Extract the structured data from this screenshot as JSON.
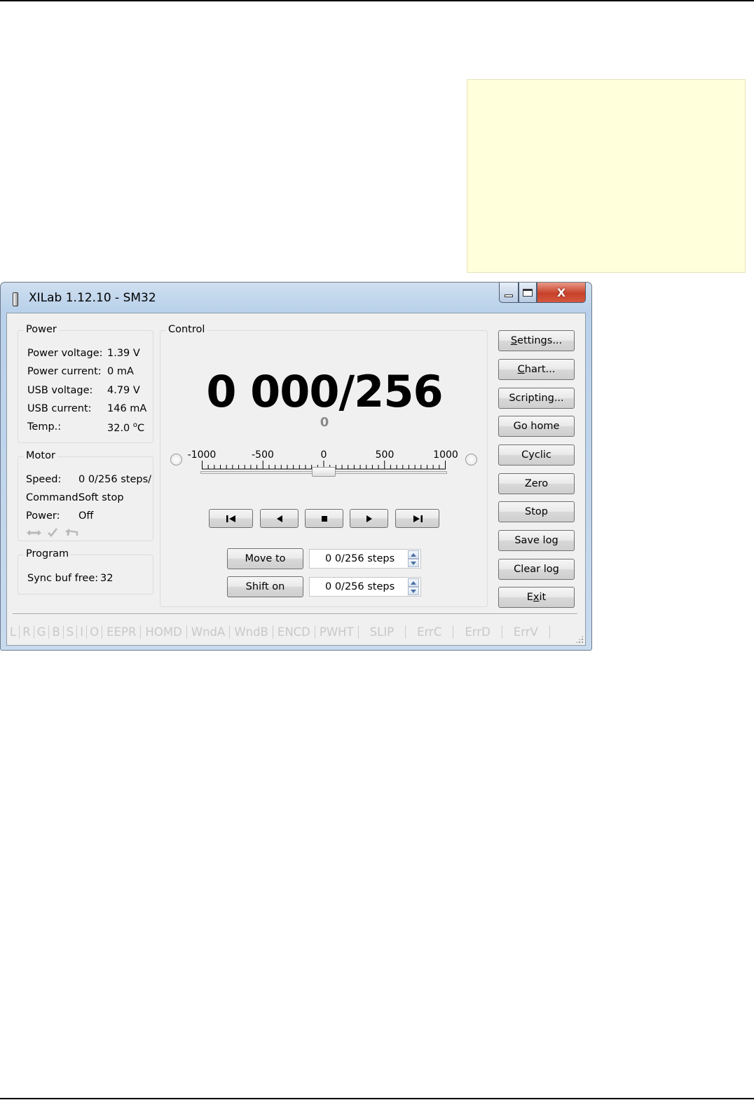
{
  "window": {
    "title": "XILab 1.12.10 - SM32",
    "close_glyph": "X"
  },
  "power_group": {
    "label": "Power",
    "rows": [
      {
        "label": "Power voltage:",
        "value": "1.39 V"
      },
      {
        "label": "Power current:",
        "value": "0 mA"
      },
      {
        "label": "USB voltage:",
        "value": "4.79 V"
      },
      {
        "label": "USB current:",
        "value": "146 mA"
      },
      {
        "label": "Temp.:",
        "value": "32.0",
        "unit_sup": "o",
        "unit": "C"
      }
    ]
  },
  "motor_group": {
    "label": "Motor",
    "speed_label": "Speed:",
    "speed_value": "0 0/256 steps/",
    "command_label": "Command:",
    "command_value": "Soft stop",
    "power_label": "Power:",
    "power_value": "Off",
    "status_icons": [
      "move-arrows-icon",
      "checkmark-icon",
      "return-arrow-icon"
    ]
  },
  "program_group": {
    "label": "Program",
    "sync_label": "Sync buf free:",
    "sync_value": "32"
  },
  "control_group": {
    "label": "Control",
    "position_main": "0 000/256",
    "position_encoder": "0",
    "scale_labels": [
      "-1000",
      "-500",
      "0",
      "500",
      "1000"
    ],
    "slider_value": 0,
    "move_to_label": "Move to",
    "move_to_value": "0 0/256 steps",
    "shift_on_label": "Shift on",
    "shift_on_value": "0 0/256 steps",
    "nav_icons": [
      "skip-left-icon",
      "step-left-icon",
      "stop-icon",
      "step-right-icon",
      "skip-right-icon"
    ]
  },
  "side_buttons": [
    {
      "label": "Settings...",
      "mnemonic": "S",
      "rest": "ettings..."
    },
    {
      "label": "Chart...",
      "mnemonic": "C",
      "rest": "hart..."
    },
    {
      "label": "Scripting..."
    },
    {
      "label": "Go home"
    },
    {
      "label": "Cyclic"
    },
    {
      "label": "Zero"
    },
    {
      "label": "Stop"
    },
    {
      "label": "Save log"
    },
    {
      "label": "Clear log"
    },
    {
      "label": "Exit",
      "pre": "E",
      "mnemonic": "x",
      "rest": "it"
    }
  ],
  "status_flags": [
    "L",
    "R",
    "G",
    "B",
    "S",
    "I",
    "O",
    "EEPR",
    "HOMD",
    "WndA",
    "WndB",
    "ENCD",
    "PWHT",
    "SLIP",
    "ErrC",
    "ErrD",
    "ErrV"
  ],
  "colors": {
    "note_background": "#ffffdc",
    "close_button": "#c8412a",
    "flag_inactive": "#c8c8c8"
  }
}
